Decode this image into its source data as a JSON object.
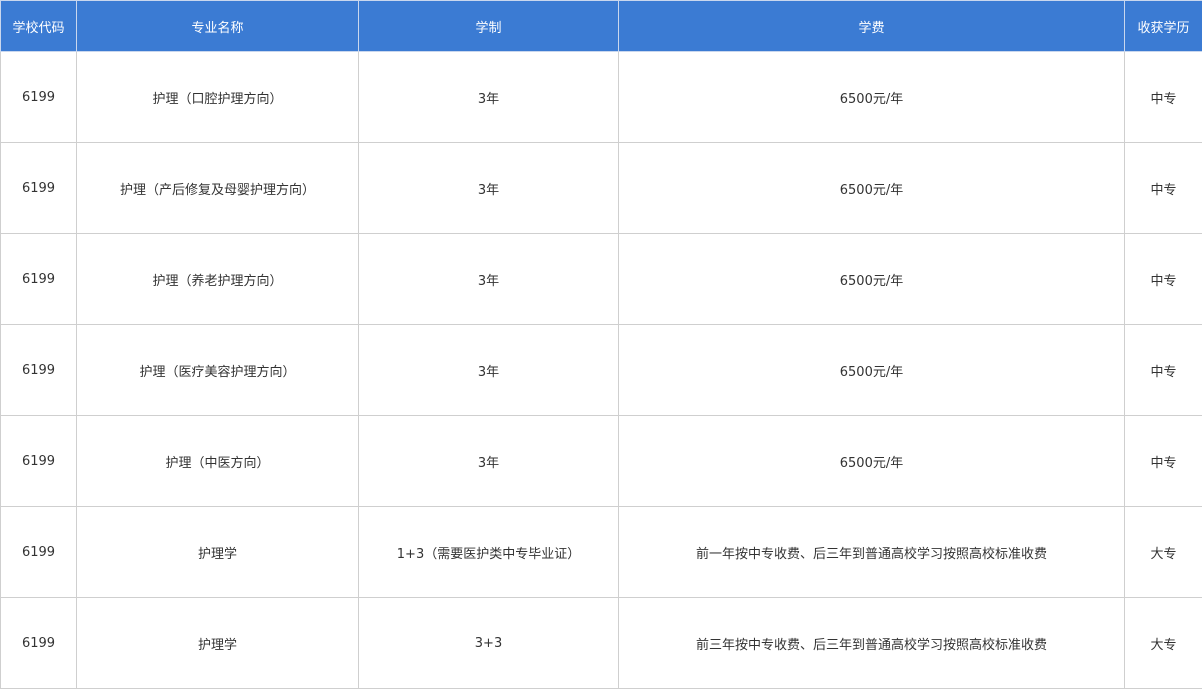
{
  "table": {
    "headers": [
      "学校代码",
      "专业名称",
      "学制",
      "学费",
      "收获学历"
    ],
    "rows": [
      [
        "6199",
        "护理（口腔护理方向）",
        "3年",
        "6500元/年",
        "中专"
      ],
      [
        "6199",
        "护理（产后修复及母婴护理方向）",
        "3年",
        "6500元/年",
        "中专"
      ],
      [
        "6199",
        "护理（养老护理方向）",
        "3年",
        "6500元/年",
        "中专"
      ],
      [
        "6199",
        "护理（医疗美容护理方向）",
        "3年",
        "6500元/年",
        "中专"
      ],
      [
        "6199",
        "护理（中医方向）",
        "3年",
        "6500元/年",
        "中专"
      ],
      [
        "6199",
        "护理学",
        "1+3（需要医护类中专毕业证）",
        "前一年按中专收费、后三年到普通高校学习按照高校标准收费",
        "大专"
      ],
      [
        "6199",
        "护理学",
        "3+3",
        "前三年按中专收费、后三年到普通高校学习按照高校标准收费",
        "大专"
      ]
    ]
  },
  "colors": {
    "header_background": "#3b7bd3",
    "header_text": "#ffffff",
    "border": "#cfcfcf",
    "body_text": "#333333"
  }
}
